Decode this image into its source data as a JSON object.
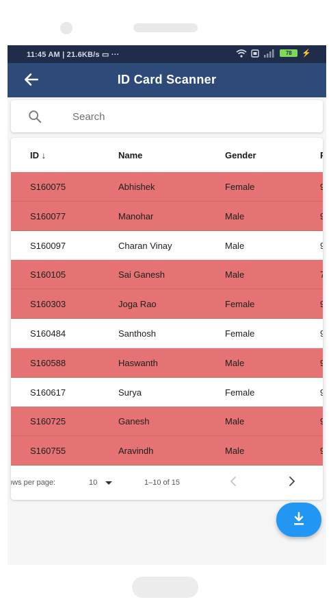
{
  "status_bar": {
    "time": "11:45 AM | 21.6KB/s",
    "battery": "78"
  },
  "app_bar": {
    "title": "ID Card Scanner"
  },
  "search": {
    "placeholder": "Search"
  },
  "table": {
    "columns": {
      "id": "ID",
      "name": "Name",
      "gender": "Gender",
      "extra": "P"
    },
    "sort_indicator": "↓",
    "rows": [
      {
        "id": "S160075",
        "name": "Abhishek",
        "gender": "Female",
        "extra": "9",
        "highlighted": true
      },
      {
        "id": "S160077",
        "name": "Manohar",
        "gender": "Male",
        "extra": "9",
        "highlighted": true
      },
      {
        "id": "S160097",
        "name": "Charan Vinay",
        "gender": "Male",
        "extra": "9",
        "highlighted": false
      },
      {
        "id": "S160105",
        "name": "Sai Ganesh",
        "gender": "Male",
        "extra": "7",
        "highlighted": true
      },
      {
        "id": "S160303",
        "name": "Joga Rao",
        "gender": "Female",
        "extra": "9",
        "highlighted": true
      },
      {
        "id": "S160484",
        "name": "Santhosh",
        "gender": "Female",
        "extra": "9",
        "highlighted": false
      },
      {
        "id": "S160588",
        "name": "Haswanth",
        "gender": "Male",
        "extra": "9",
        "highlighted": true
      },
      {
        "id": "S160617",
        "name": "Surya",
        "gender": "Female",
        "extra": "9",
        "highlighted": false
      },
      {
        "id": "S160725",
        "name": "Ganesh",
        "gender": "Male",
        "extra": "9",
        "highlighted": true
      },
      {
        "id": "S160755",
        "name": "Aravindh",
        "gender": "Male",
        "extra": "9",
        "highlighted": true
      }
    ]
  },
  "pagination": {
    "rows_per_page_label": "ows per page:",
    "rows_per_page_value": "10",
    "range": "1–10 of 15"
  },
  "fab": {
    "icon": "download-icon"
  },
  "colors": {
    "status_bar": "#1f2d4a",
    "app_bar": "#2e4a78",
    "highlight_row": "#e57373",
    "fab": "#2196f3"
  }
}
